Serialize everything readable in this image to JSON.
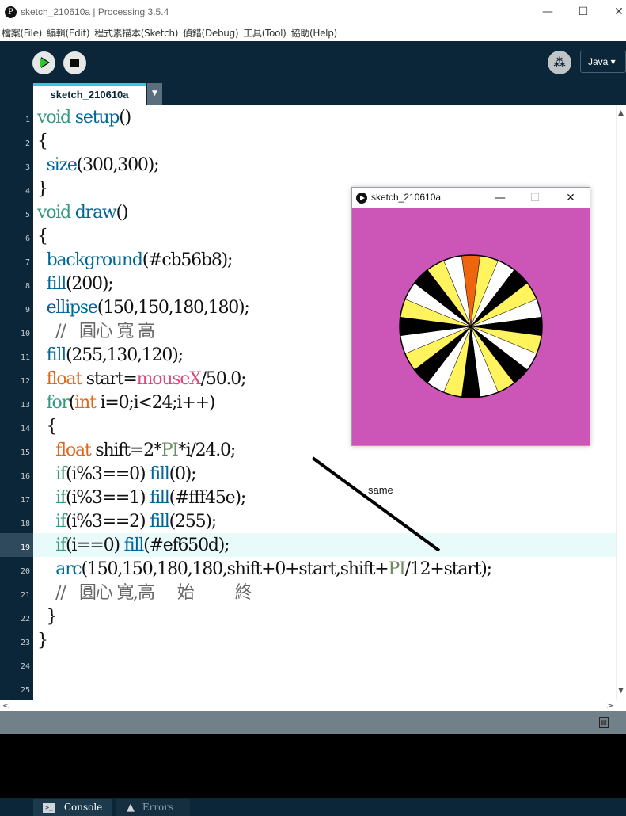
{
  "window": {
    "title": "sketch_210610a | Processing 3.5.4",
    "app_icon_glyph": "P",
    "minimize": "—",
    "maximize": "☐",
    "close": "✕"
  },
  "menu": [
    "檔案(File)",
    "編輯(Edit)",
    "程式素描本(Sketch)",
    "偵錯(Debug)",
    "工具(Tool)",
    "協助(Help)"
  ],
  "toolbar": {
    "debug_glyph": "⁂",
    "mode_label": "Java ▾"
  },
  "editor": {
    "tab_label": "sketch_210610a",
    "tab_menu_glyph": "▼",
    "current_line": 19,
    "line_numbers": [
      "1",
      "2",
      "3",
      "4",
      "5",
      "6",
      "7",
      "8",
      "9",
      "10",
      "11",
      "12",
      "13",
      "14",
      "15",
      "16",
      "17",
      "18",
      "19",
      "20",
      "21",
      "22",
      "23",
      "24",
      "25"
    ]
  },
  "sketch_window": {
    "title": "sketch_210610a",
    "minimize": "—",
    "maximize": "☐",
    "close": "✕",
    "background": "#cb56b8",
    "wheel": {
      "base_fill": "#c8c8c8",
      "segments": 24,
      "colors": [
        "#000000",
        "#fff45e",
        "#ffffff"
      ],
      "first_segment_color": "#ef650d"
    }
  },
  "annotation": {
    "text": "same"
  },
  "scroll": {
    "up": "▲",
    "down": "▼",
    "left": "<",
    "right": ">"
  },
  "status": {
    "icon_glyph": "▤"
  },
  "bottom_tabs": {
    "console_label": "Console",
    "errors_label": "Errors",
    "console_icon": ">_",
    "errors_icon": "▲"
  },
  "colors": {
    "ide_dark": "#0b2638",
    "tab_accent": "#2ec9e8",
    "run_green": "#2ec92e",
    "current_line_bg": "#e9fafa"
  }
}
